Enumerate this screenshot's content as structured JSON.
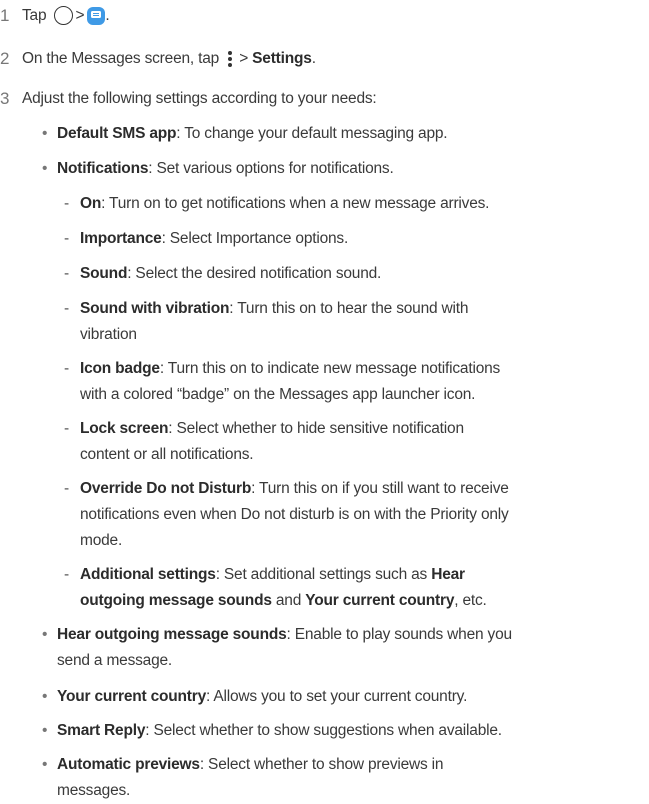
{
  "steps": [
    {
      "num": "1",
      "tap": "Tap",
      "gt": ">",
      "end": "."
    },
    {
      "num": "2",
      "pre": "On the Messages screen, tap",
      "gt": ">",
      "bold": "Settings",
      "end": "."
    },
    {
      "num": "3",
      "text": "Adjust the following settings according to your needs:"
    }
  ],
  "bullets": [
    {
      "term": "Default SMS app",
      "desc": ": To change your default messaging app."
    },
    {
      "term": "Notifications",
      "desc": ": Set various options for notifications."
    }
  ],
  "sub": [
    {
      "term": "On",
      "desc": ": Turn on to get notifications when a new message arrives."
    },
    {
      "term": "Importance",
      "desc": ": Select Importance options."
    },
    {
      "term": "Sound",
      "desc": ": Select the desired notification sound."
    },
    {
      "term": "Sound with vibration",
      "desc1": ": Turn this on to hear the sound with",
      "desc2": "vibration"
    },
    {
      "term": "Icon badge",
      "desc1": ": Turn this on to indicate new message notifications",
      "desc2": "with a colored “badge” on the Messages app launcher icon."
    },
    {
      "term": "Lock screen",
      "desc1": ": Select whether to hide sensitive notification",
      "desc2": "content or all notifications."
    },
    {
      "term": "Override Do not Disturb",
      "desc1": ": Turn this on if you still want to receive",
      "desc2": "notifications even when Do not disturb is on with the Priority only",
      "desc3": "mode."
    },
    {
      "term": "Additional settings",
      "desc1a": ": Set additional settings such as",
      "bold1": "Hear",
      "bold2": "outgoing message sounds",
      "and": "and",
      "bold3": "Your current country",
      "etc": ", etc."
    }
  ],
  "bullets2": [
    {
      "term": "Hear outgoing message sounds",
      "desc1": ": Enable to play sounds when you",
      "desc2": "send a message."
    },
    {
      "term": "Your current country",
      "desc": ": Allows you to set your current country."
    },
    {
      "term": "Smart Reply",
      "desc": ": Select whether to show suggestions when available."
    },
    {
      "term": "Automatic previews",
      "desc1": ": Select whether to show previews in",
      "desc2": "messages."
    }
  ],
  "glyphs": {
    "bullet": "•",
    "dash": "-"
  },
  "icons": {
    "home": "home-circle-icon",
    "messages": "messages-app-icon",
    "more": "more-options-icon"
  },
  "colors": {
    "text": "#3a3a3a",
    "number": "#777777",
    "messages_icon": "#3f9ae6"
  }
}
